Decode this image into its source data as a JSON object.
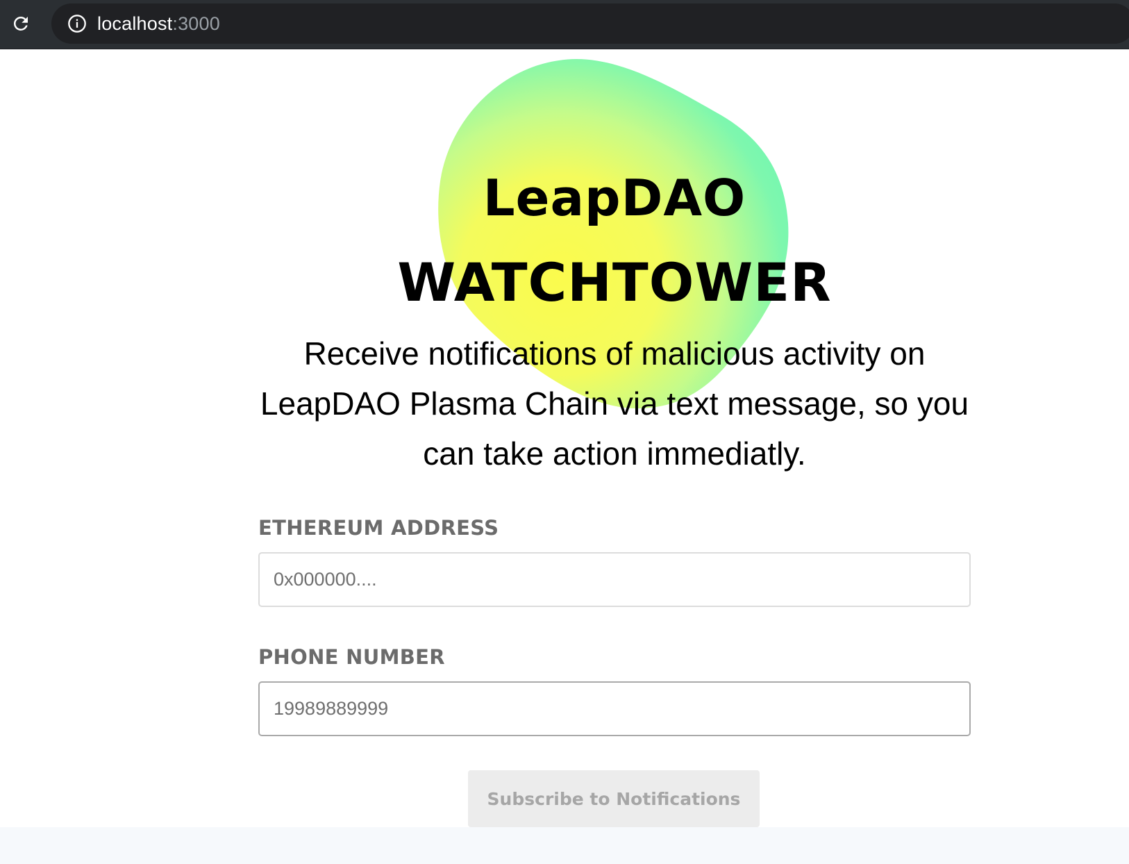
{
  "browser": {
    "url_host": "localhost",
    "url_port": ":3000"
  },
  "hero": {
    "title_line1": "LeapDAO",
    "title_line2": "WATCHTOWER",
    "description": "Receive notifications of malicious activity on LeapDAO Plasma Chain via text message, so you can take action immediatly."
  },
  "form": {
    "eth_label": "ETHEREUM ADDRESS",
    "eth_placeholder": "0x000000....",
    "phone_label": "PHONE NUMBER",
    "phone_placeholder": "19989889999",
    "submit_label": "Subscribe to Notifications"
  },
  "colors": {
    "blob_yellow": "#f9fb56",
    "blob_green": "#7cf7b0",
    "label_gray": "#6b6b6b",
    "button_bg": "#ececec",
    "button_text": "#a6a6a6"
  },
  "icons": {
    "reload": "reload-icon",
    "info": "info-icon"
  }
}
